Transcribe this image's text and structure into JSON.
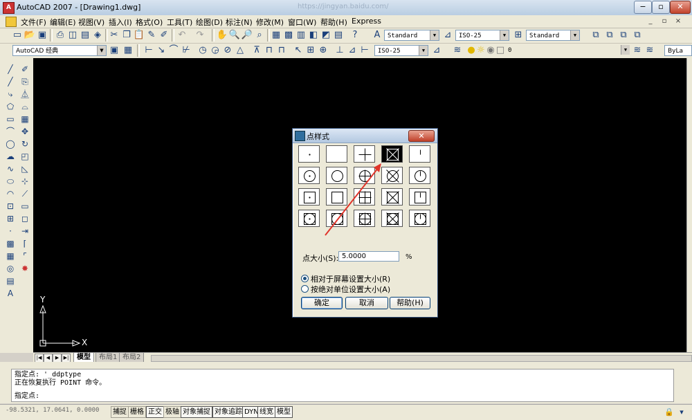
{
  "window": {
    "title": "AutoCAD 2007 - [Drawing1.dwg]",
    "app_icon": "autocad-icon",
    "watermark": "https://jingyan.baidu.com/",
    "controls": [
      "−",
      "▫",
      "✕"
    ]
  },
  "menu": {
    "items": [
      "文件(F)",
      "编辑(E)",
      "视图(V)",
      "插入(I)",
      "格式(O)",
      "工具(T)",
      "绘图(D)",
      "标注(N)",
      "修改(M)",
      "窗口(W)",
      "帮助(H)",
      "Express"
    ],
    "doc_controls": [
      "_",
      "▫",
      "×"
    ]
  },
  "toolbar1": {
    "text_style": "Standard",
    "dim_style": "ISO-25",
    "table_style": "Standard"
  },
  "toolbar2": {
    "workspace": "AutoCAD 经典",
    "dim_style2": "ISO-25",
    "layer": "0",
    "linetype": "ByLa"
  },
  "canvas": {
    "axis_y": "Y",
    "axis_x": "X",
    "background": "#000000"
  },
  "tabs": {
    "items": [
      "模型",
      "布局1",
      "布局2"
    ],
    "active": "模型"
  },
  "command": {
    "lines": [
      "指定点: '_ddptype",
      "正在恢复执行 POINT 命令。"
    ],
    "prompt": "指定点:"
  },
  "status": {
    "coords": "-98.5321, 17.0641, 0.0000",
    "buttons": [
      "捕捉",
      "栅格",
      "正交",
      "极轴",
      "对象捕捉",
      "对象追踪",
      "DYN",
      "线宽",
      "模型"
    ],
    "on": [
      "正交",
      "对象捕捉",
      "对象追踪",
      "DYN",
      "线宽",
      "模型"
    ]
  },
  "dialog": {
    "title": "点样式",
    "close": "✕",
    "selected_style_index": 3,
    "point_size_label": "点大小(S):",
    "point_size_value": "5.0000",
    "percent": "%",
    "radio_relative": "相对于屏幕设置大小(R)",
    "radio_absolute": "按绝对单位设置大小(A)",
    "radio_selected": "relative",
    "ok": "确定",
    "cancel": "取消",
    "help": "帮助(H)"
  },
  "annotation": {
    "arrow_color": "#e0342a"
  }
}
